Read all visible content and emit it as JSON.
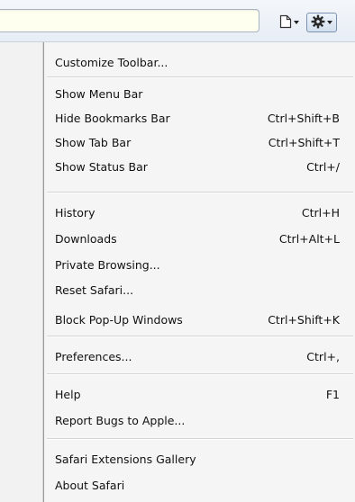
{
  "toolbar": {
    "address_value": "",
    "page_icon": "page-menu-icon",
    "gear_icon": "gear-menu-icon"
  },
  "menu": {
    "items": [
      {
        "label": "Customize Toolbar...",
        "shortcut": ""
      },
      {
        "label": "Show Menu Bar",
        "shortcut": ""
      },
      {
        "label": "Hide Bookmarks Bar",
        "shortcut": "Ctrl+Shift+B"
      },
      {
        "label": "Show Tab Bar",
        "shortcut": "Ctrl+Shift+T"
      },
      {
        "label": "Show Status Bar",
        "shortcut": "Ctrl+/"
      },
      {
        "label": "History",
        "shortcut": "Ctrl+H"
      },
      {
        "label": "Downloads",
        "shortcut": "Ctrl+Alt+L"
      },
      {
        "label": "Private Browsing...",
        "shortcut": ""
      },
      {
        "label": "Reset Safari...",
        "shortcut": ""
      },
      {
        "label": "Block Pop-Up Windows",
        "shortcut": "Ctrl+Shift+K"
      },
      {
        "label": "Preferences...",
        "shortcut": "Ctrl+,"
      },
      {
        "label": "Help",
        "shortcut": "F1"
      },
      {
        "label": "Report Bugs to Apple...",
        "shortcut": ""
      },
      {
        "label": "Safari Extensions Gallery",
        "shortcut": ""
      },
      {
        "label": "About Safari",
        "shortcut": ""
      }
    ]
  }
}
